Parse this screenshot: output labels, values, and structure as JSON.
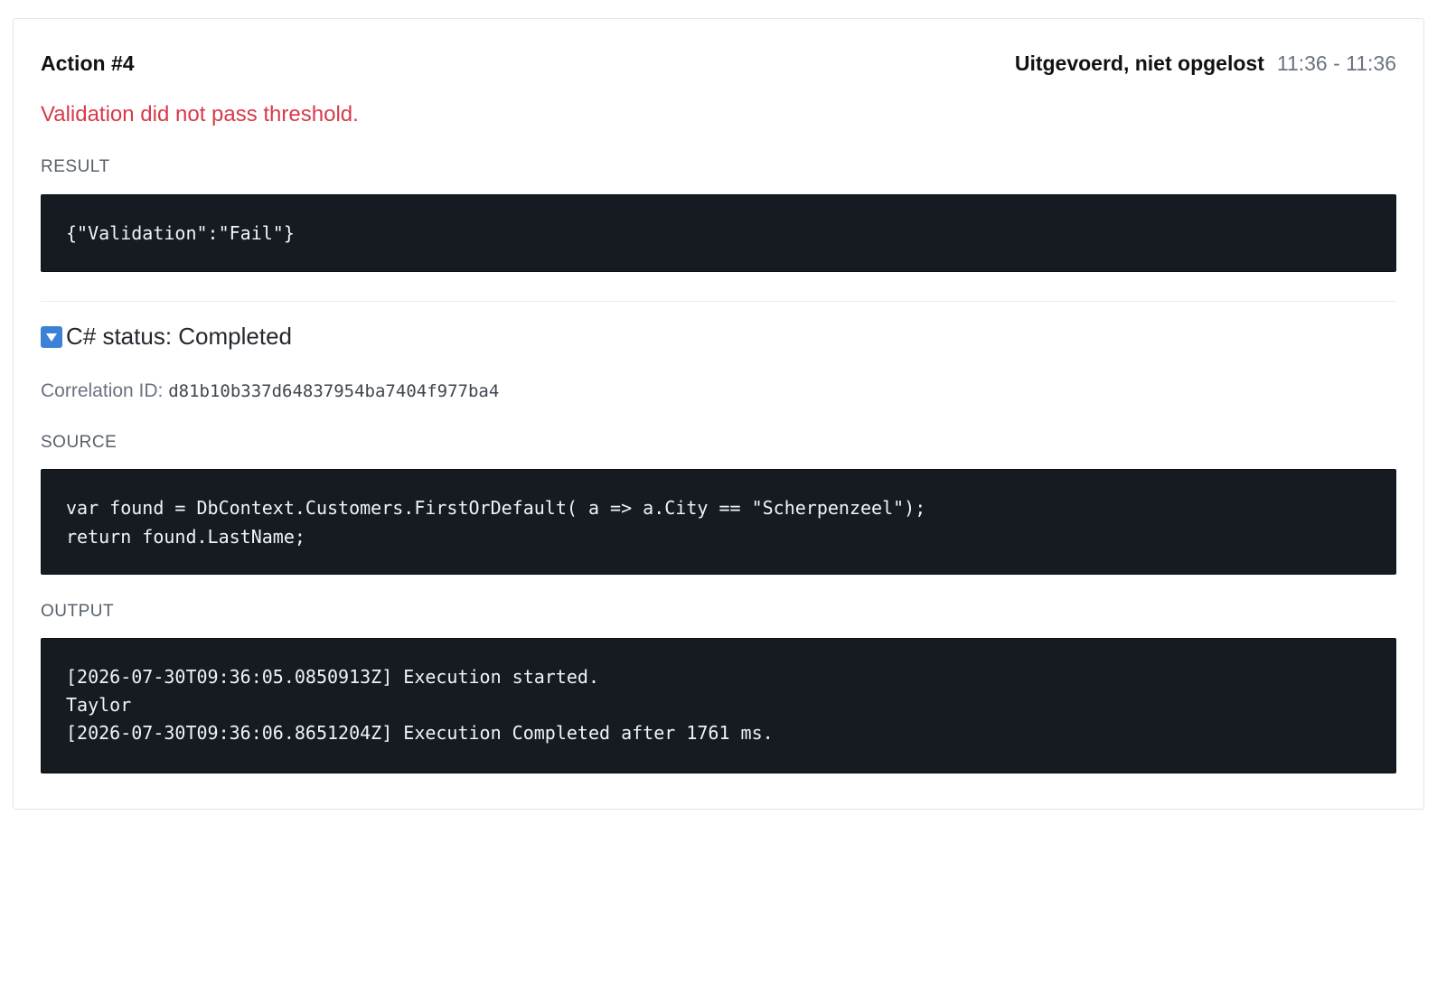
{
  "action": {
    "title": "Action #4",
    "status": "Uitgevoerd, niet opgelost",
    "time_range": "11:36 - 11:36",
    "error_message": "Validation did not pass threshold."
  },
  "result": {
    "label": "RESULT",
    "code": "{\"Validation\":\"Fail\"}"
  },
  "csharp": {
    "toggle_icon": "triangle-down-icon",
    "status_title": "C# status: Completed",
    "correlation_label": "Correlation ID: ",
    "correlation_id": "d81b10b337d64837954ba7404f977ba4"
  },
  "source": {
    "label": "SOURCE",
    "lines": [
      "var found = DbContext.Customers.FirstOrDefault( a => a.City == \"Scherpenzeel\");",
      "return found.LastName;"
    ]
  },
  "output": {
    "label": "OUTPUT",
    "lines": [
      "[2026-07-30T09:36:05.0850913Z] Execution started.",
      "Taylor",
      "[2026-07-30T09:36:06.8651204Z] Execution Completed after 1761 ms."
    ]
  },
  "colors": {
    "error": "#d73a49",
    "code_bg": "#161b22",
    "toggle": "#3b82d6"
  }
}
